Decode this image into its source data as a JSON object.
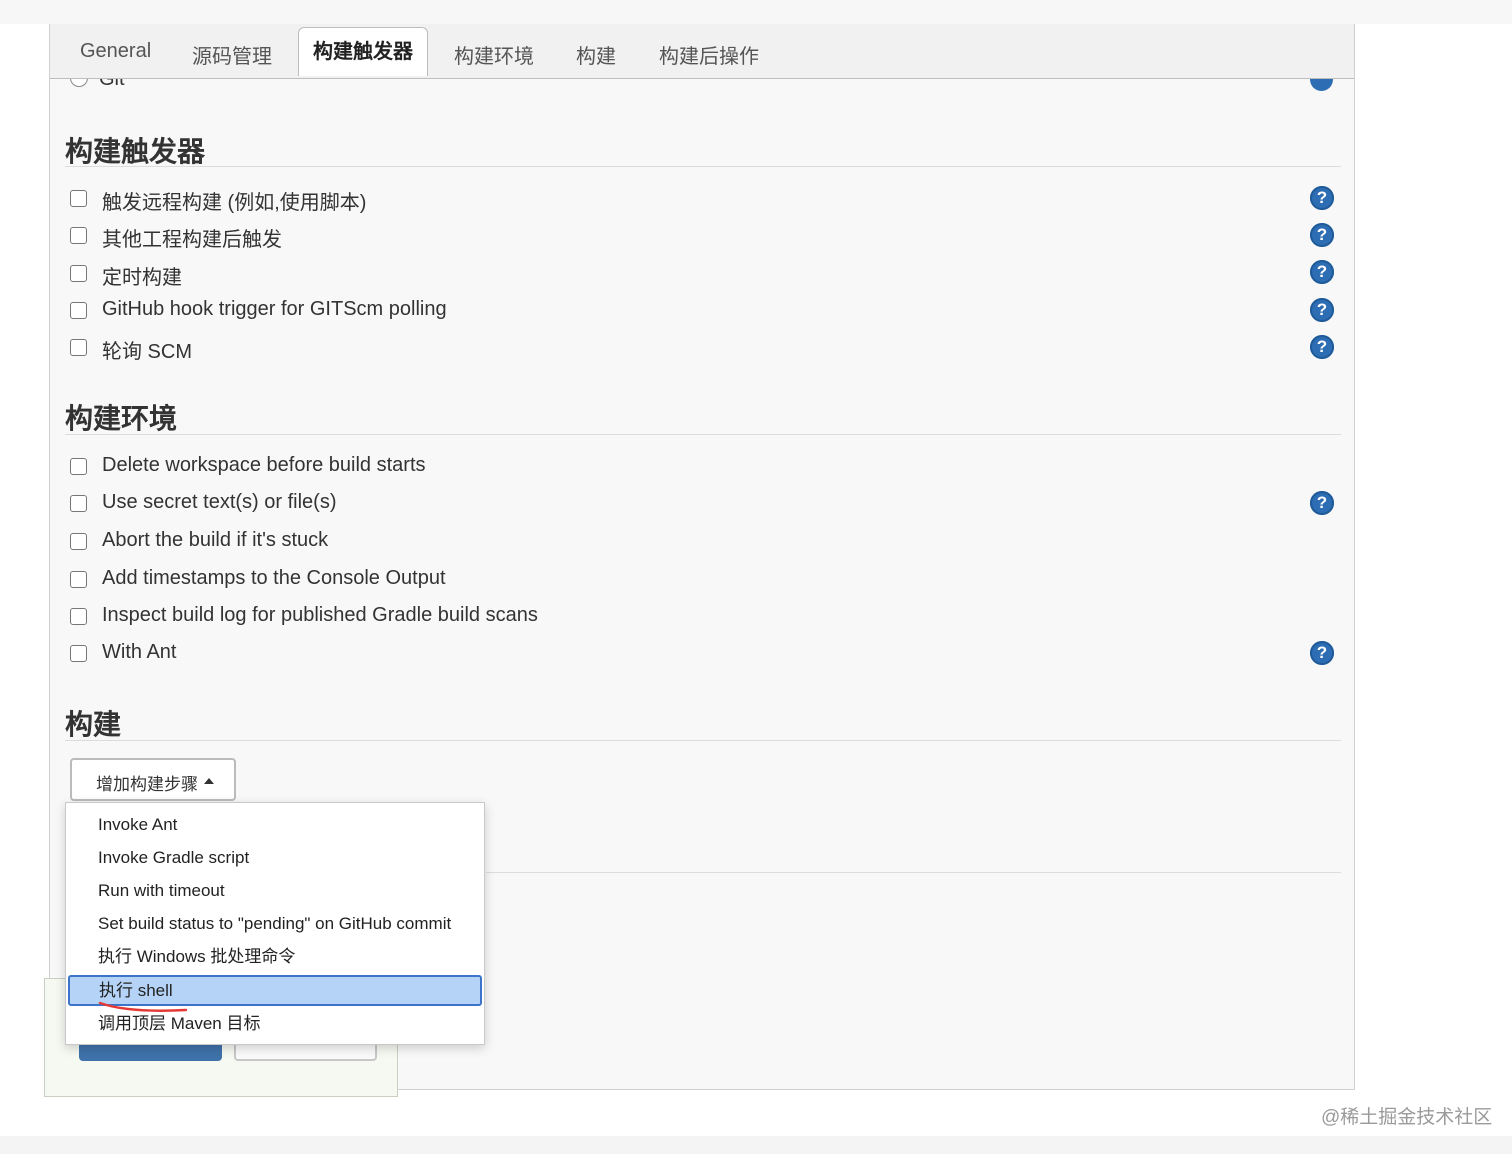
{
  "tabs": [
    "General",
    "源码管理",
    "构建触发器",
    "构建环境",
    "构建",
    "构建后操作"
  ],
  "active_tab_index": 2,
  "scm": {
    "git_label": "Git",
    "git_selected": false
  },
  "build_triggers": {
    "title": "构建触发器",
    "options": [
      {
        "label": "触发远程构建 (例如,使用脚本)",
        "checked": false,
        "help": true
      },
      {
        "label": "其他工程构建后触发",
        "checked": false,
        "help": true
      },
      {
        "label": "定时构建",
        "checked": false,
        "help": true
      },
      {
        "label": "GitHub hook trigger for GITScm polling",
        "checked": false,
        "help": true
      },
      {
        "label": "轮询 SCM",
        "checked": false,
        "help": true
      }
    ]
  },
  "build_env": {
    "title": "构建环境",
    "options": [
      {
        "label": "Delete workspace before build starts",
        "checked": false,
        "help": false
      },
      {
        "label": "Use secret text(s) or file(s)",
        "checked": false,
        "help": true
      },
      {
        "label": "Abort the build if it's stuck",
        "checked": false,
        "help": false
      },
      {
        "label": "Add timestamps to the Console Output",
        "checked": false,
        "help": false
      },
      {
        "label": "Inspect build log for published Gradle build scans",
        "checked": false,
        "help": false
      },
      {
        "label": "With Ant",
        "checked": false,
        "help": true
      }
    ]
  },
  "build": {
    "title": "构建",
    "add_step_label": "增加构建步骤",
    "dropdown_items": [
      "Invoke Ant",
      "Invoke Gradle script",
      "Run with timeout",
      "Set build status to \"pending\" on GitHub commit",
      "执行 Windows 批处理命令",
      "执行 shell",
      "调用顶层 Maven 目标"
    ],
    "selected_item_index": 5
  },
  "help_glyph": "?",
  "colors": {
    "help_icon": "#2d6db3",
    "selected_item_bg": "#b5d3f7",
    "selected_item_border": "#3b74c8",
    "annotation": "#e53935"
  },
  "watermark": "@稀土掘金技术社区"
}
